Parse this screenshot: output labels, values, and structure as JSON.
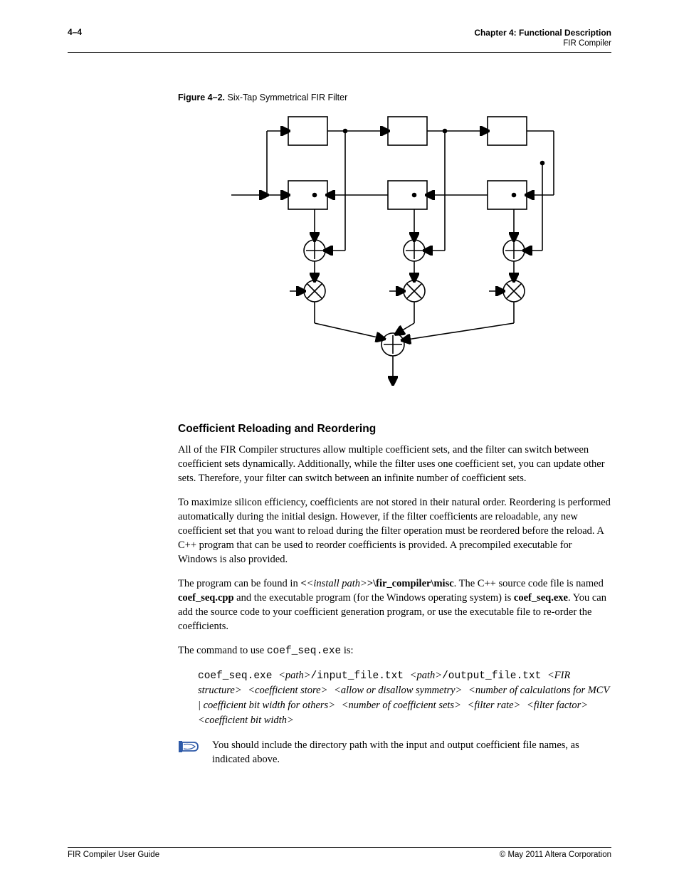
{
  "header": {
    "page_num": "4–4",
    "chapter_line": "Chapter 4: Functional Description",
    "subline": "FIR Compiler"
  },
  "figure": {
    "label": "Figure 4–2.",
    "title": "Six-Tap Symmetrical FIR Filter"
  },
  "section_heading": "Coefficient Reloading and Reordering",
  "p1": "All of the FIR Compiler structures allow multiple coefficient sets, and the filter can switch between coefficient sets dynamically. Additionally, while the filter uses one coefficient set, you can update other sets. Therefore, your filter can switch between an infinite number of coefficient sets.",
  "p2": "To maximize silicon efficiency, coefficients are not stored in their natural order. Reordering is performed automatically during the initial design. However, if the filter coefficients are reloadable, any new coefficient set that you want to reload during the filter operation must be reordered before the reload. A C++ program that can be used to reorder coefficients is provided. A precompiled executable for Windows is also provided.",
  "p3_a": "The program can be found in ",
  "p3_b": "<install path>",
  "p3_c": "\\fir_compiler\\misc",
  "p3_d": ". The C++ source code file is named ",
  "p3_e": "coef_seq.cpp",
  "p3_f": " and the executable program (for the Windows operating system) is ",
  "p3_g": "coef_seq.exe",
  "p3_h": ". You can add the source code to your coefficient generation program, or use the executable file to re-order the coefficients.",
  "p4_a": "The command to use ",
  "p4_b": "coef_seq.exe",
  "p4_c": " is:",
  "cmd": {
    "exe": "coef_seq.exe",
    "path_a": "<path>",
    "slash": "/",
    "in": "input_file.txt ",
    "path_b": "<path>",
    "out": "output_file.txt ",
    "fir_struct": "<FIR structure>",
    "coef_store": "<coefficient store>",
    "sym": "<allow or disallow symmetry>",
    "calc": "<number of calculations for MCV | coefficient bit width for others>",
    "sets": "<number of coefficient sets>",
    "rate": "<filter rate>",
    "factor": "<filter factor>",
    "width": "<coefficient bit width>"
  },
  "note": "You should include the directory path with the input and output coefficient file names, as indicated above.",
  "footer": {
    "left": "FIR Compiler User Guide",
    "right": "© May 2011   Altera Corporation"
  }
}
